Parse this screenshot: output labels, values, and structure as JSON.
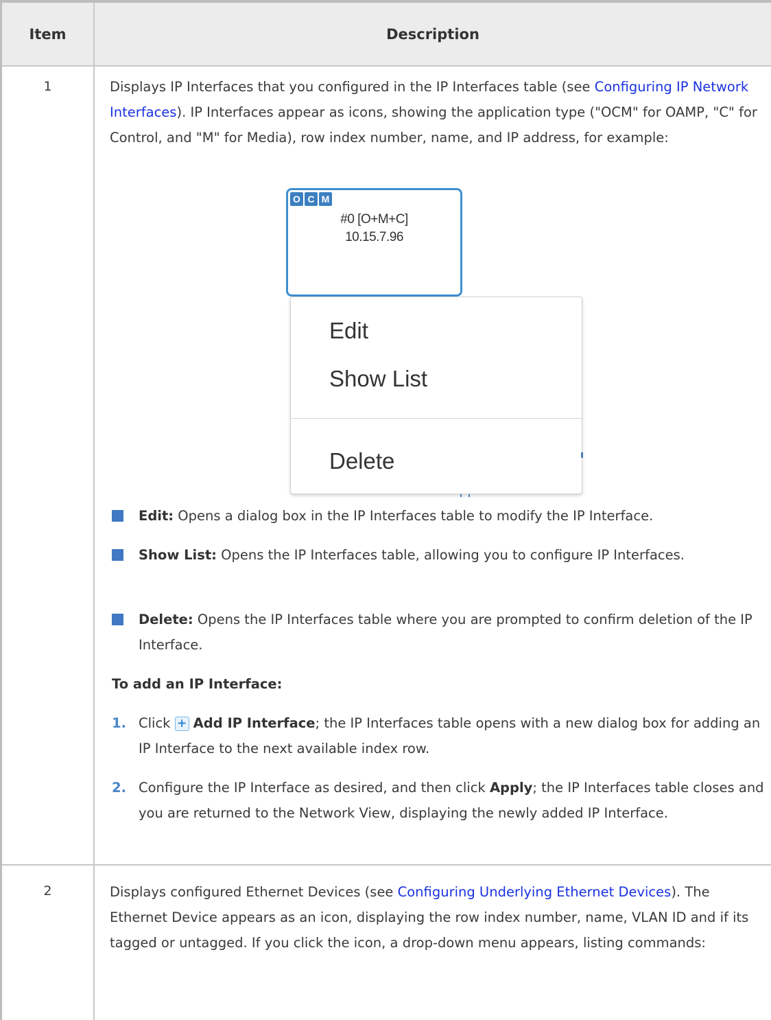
{
  "table": {
    "header_item": "Item",
    "header_description": "Description"
  },
  "row1": {
    "number": "1",
    "intro_before_link": "Displays IP Interfaces that you configured in the IP Interfaces table (see ",
    "intro_link": "Configuring IP Network Interfaces",
    "intro_after_link": "). IP Interfaces appear as icons, showing the application type (\"OCM\" for OAMP, \"C\" for Control, and \"M\" for Media), row index number, name, and IP address, for example:",
    "ip_icon": {
      "badges": [
        "O",
        "C",
        "M"
      ],
      "name": "#0 [O+M+C]",
      "address": "10.15.7.96"
    },
    "menu": {
      "edit": "Edit",
      "show_list": "Show List",
      "delete": "Delete"
    },
    "bullets": {
      "edit_label": "Edit:",
      "edit_text": " Opens a dialog box in the IP Interfaces table to modify the IP Interface.",
      "show_list_label": "Show List:",
      "show_list_text": " Opens the IP Interfaces table, allowing you to configure IP Interfaces.",
      "delete_label": "Delete:",
      "delete_text": " Opens the IP Interfaces table where you are prompted to confirm deletion of the IP Interface."
    },
    "procedure_title": "To add an IP Interface:",
    "steps": {
      "step1_num": "1.",
      "step1_pre": "Click ",
      "step1_icon": "+",
      "step1_bold": "Add IP Interface",
      "step1_text": "; the IP Interfaces table opens with a new dialog box for adding an IP Interface to the next available index row.",
      "step2_num": "2.",
      "step2_pre": "Configure the IP Interface as desired, and then click ",
      "step2_bold": "Apply",
      "step2_text": "; the IP Interfaces table closes and you are returned to the Network View, displaying the newly added IP Interface."
    }
  },
  "row2": {
    "number": "2",
    "intro_before_link": "Displays configured Ethernet Devices (see ",
    "intro_link": "Configuring Underlying Ethernet Devices",
    "intro_after_link": "). The Ethernet Device appears as an icon, displaying the row index number, name, VLAN ID and if its tagged or untagged. If you click the icon, a drop-down menu appears, listing commands:"
  },
  "colors": {
    "link": "#1a32e0",
    "bullet": "#3f78c3",
    "header_bg": "#ececec",
    "icon_border": "#3f8fd0"
  }
}
